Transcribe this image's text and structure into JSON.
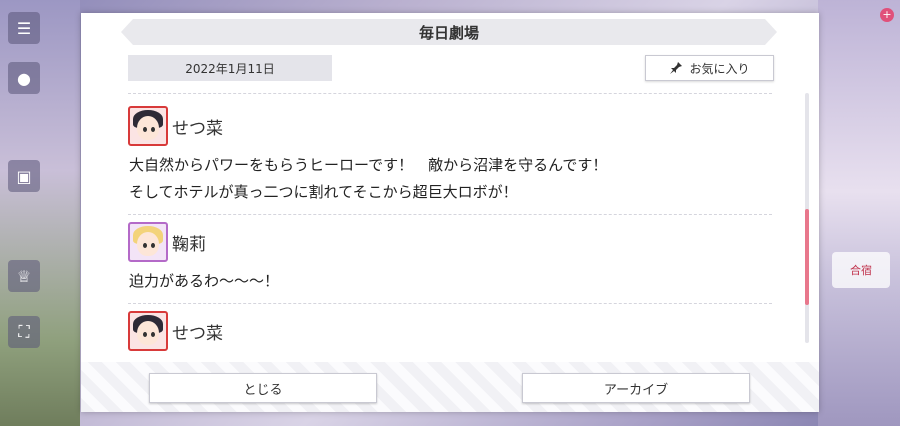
{
  "dialog": {
    "title": "毎日劇場",
    "date": "2022年1月11日",
    "favorite_label": "お気に入り"
  },
  "messages": [
    {
      "speaker": "せつ菜",
      "lines": [
        "大自然からパワーをもらうヒーローです！　敵から沼津を守るんです！",
        "そしてホテルが真っ二つに割れてそこから超巨大ロボが！"
      ]
    },
    {
      "speaker": "鞠莉",
      "lines": [
        "迫力があるわ～～～！"
      ]
    },
    {
      "speaker": "せつ菜",
      "lines": []
    }
  ],
  "footer": {
    "close_label": "とじる",
    "archive_label": "アーカイブ"
  },
  "background": {
    "right_badge": "合宿"
  },
  "scroll": {
    "position": 0.75
  },
  "colors": {
    "accent_scroll": "#e8778c",
    "setsuna_frame": "#d83a3a",
    "mari_frame": "#b46ac8"
  },
  "icons": [
    "pin-icon",
    "menu-icon",
    "chat-icon",
    "gift-icon",
    "trophy-icon",
    "expand-icon"
  ]
}
